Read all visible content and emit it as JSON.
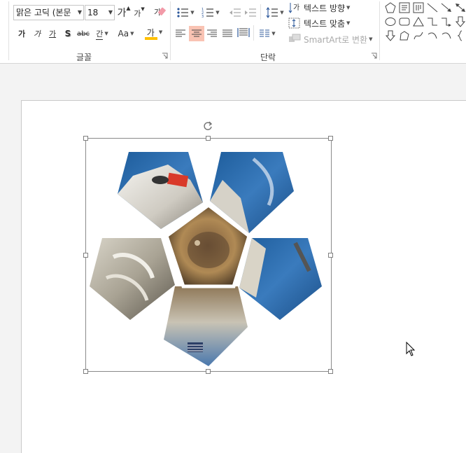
{
  "ribbon": {
    "font_group": {
      "label": "글꼴",
      "font_name": "맑은 고딕 (본문",
      "font_size": "18",
      "grow_font": "가",
      "shrink_font": "가",
      "clear_format": "가",
      "bold": "가",
      "italic": "가",
      "underline": "가",
      "shadow": "S",
      "strike": "abc",
      "spacing": "간",
      "case": "Aa",
      "font_color": "가"
    },
    "paragraph_group": {
      "label": "단락",
      "text_direction": "텍스트 방향",
      "align_text": "텍스트 맞춤",
      "smartart": "SmartArt로 변환"
    }
  },
  "colors": {
    "accent": "#f9c3b3",
    "font_color_bar": "#ffc000",
    "sky": "#2c6aa8"
  }
}
